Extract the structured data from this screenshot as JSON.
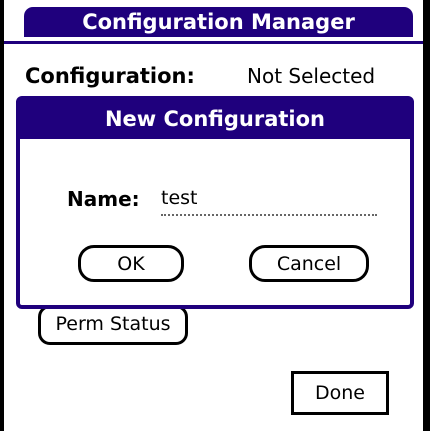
{
  "colors": {
    "accent": "#1f007d",
    "accent_text": "#ffffff",
    "background": "#ffffff",
    "text": "#000000"
  },
  "header": {
    "title": "Configuration Manager"
  },
  "configuration": {
    "label": "Configuration:",
    "value": "Not Selected"
  },
  "background_button": {
    "label": "Perm Status"
  },
  "done_button": {
    "label": "Done"
  },
  "dialog": {
    "title": "New Configuration",
    "name_label": "Name:",
    "name_value": "test",
    "ok_label": "OK",
    "cancel_label": "Cancel"
  }
}
